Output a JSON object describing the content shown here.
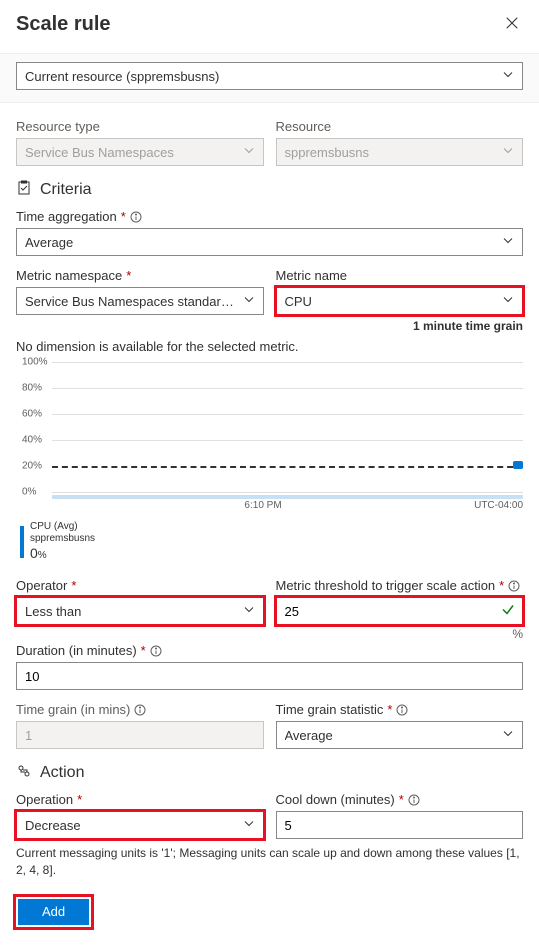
{
  "header": {
    "title": "Scale rule"
  },
  "resource_selector": {
    "value": "Current resource (sppremsbusns)"
  },
  "resource_type": {
    "label": "Resource type",
    "value": "Service Bus Namespaces"
  },
  "resource": {
    "label": "Resource",
    "value": "sppremsbusns"
  },
  "criteria": {
    "heading": "Criteria",
    "time_aggregation": {
      "label": "Time aggregation",
      "value": "Average"
    },
    "metric_namespace": {
      "label": "Metric namespace",
      "value": "Service Bus Namespaces standard me..."
    },
    "metric_name": {
      "label": "Metric name",
      "value": "CPU"
    },
    "time_grain_note": "1 minute time grain",
    "no_dimension_msg": "No dimension is available for the selected metric.",
    "operator": {
      "label": "Operator",
      "value": "Less than"
    },
    "threshold": {
      "label": "Metric threshold to trigger scale action",
      "value": "25",
      "unit": "%"
    },
    "duration": {
      "label": "Duration (in minutes)",
      "value": "10"
    },
    "time_grain_mins": {
      "label": "Time grain (in mins)",
      "value": "1"
    },
    "time_grain_stat": {
      "label": "Time grain statistic",
      "value": "Average"
    }
  },
  "action": {
    "heading": "Action",
    "operation": {
      "label": "Operation",
      "value": "Decrease"
    },
    "cooldown": {
      "label": "Cool down (minutes)",
      "value": "5"
    },
    "note": "Current messaging units is '1'; Messaging units can scale up and down among these values [1, 2, 4, 8]."
  },
  "buttons": {
    "add": "Add"
  },
  "chart_data": {
    "type": "line",
    "title": "",
    "y_ticks": [
      "100%",
      "80%",
      "60%",
      "40%",
      "20%",
      "0%"
    ],
    "x_ticks_left": "6:10 PM",
    "x_ticks_right": "UTC-04:00",
    "threshold_pct": 20,
    "series": [
      {
        "name": "CPU (Avg)",
        "resource": "sppremsbusns",
        "current_value": "0",
        "unit": "%"
      }
    ],
    "ylim": [
      0,
      100
    ]
  }
}
